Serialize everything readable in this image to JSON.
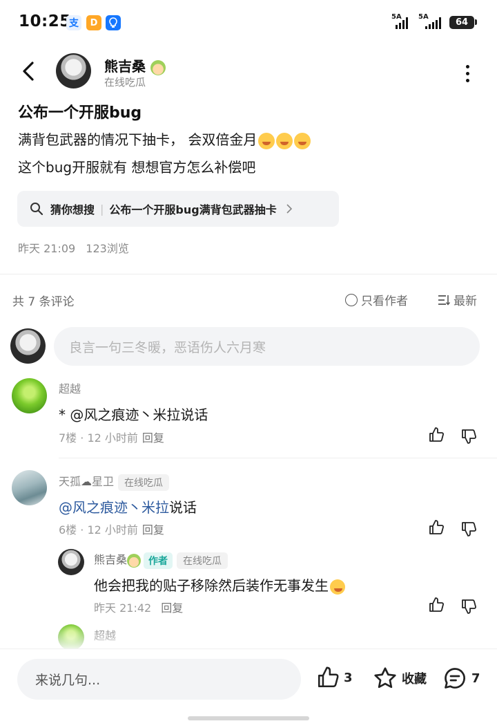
{
  "status_bar": {
    "time": "10:25",
    "app_icons": [
      {
        "name": "alipay-icon",
        "glyph": "支",
        "color": "#ffffff",
        "text_color": "#1677ff"
      },
      {
        "name": "orange-app-icon",
        "glyph": "D",
        "color": "#ffa726"
      },
      {
        "name": "bulb-app-icon",
        "glyph": "💡",
        "color": "#1677ff"
      }
    ],
    "signal1_label": "5A",
    "signal2_label": "5A",
    "battery": "64"
  },
  "header": {
    "author_name": "熊吉桑",
    "author_sub": "在线吃瓜"
  },
  "post": {
    "title": "公布一个开服bug",
    "line1": "满背包武器的情况下抽卡， 会双倍金月",
    "line2": "这个bug开服就有  想想官方怎么补偿吧",
    "search_label": "猜你想搜",
    "search_query": "公布一个开服bug满背包武器抽卡",
    "time": "昨天 21:09",
    "views": "123浏览"
  },
  "comments_header": {
    "count": "共 7 条评论",
    "only_author": "只看作者",
    "sort": "最新"
  },
  "comment_input": {
    "placeholder": "良言一句三冬暖，恶语伤人六月寒"
  },
  "comments": [
    {
      "name": "超越",
      "text": "* @风之痕迹丶米拉说话",
      "floor": "7楼",
      "time": "12 小时前",
      "reply": "回复"
    },
    {
      "name": "天孤",
      "name_suffix": "星卫",
      "tag": "在线吃瓜",
      "mention": "@风之痕迹丶米拉",
      "text": "说话",
      "floor": "6楼",
      "time": "12 小时前",
      "reply": "回复",
      "replies": [
        {
          "name": "熊吉桑",
          "author_tag": "作者",
          "tag": "在线吃瓜",
          "text": "他会把我的贴子移除然后装作无事发生",
          "time": "昨天 21:42",
          "reply": "回复"
        },
        {
          "name": "超越"
        }
      ]
    }
  ],
  "bottom_bar": {
    "placeholder": "来说几句...",
    "likes": "3",
    "favorite": "收藏",
    "comments": "7"
  }
}
